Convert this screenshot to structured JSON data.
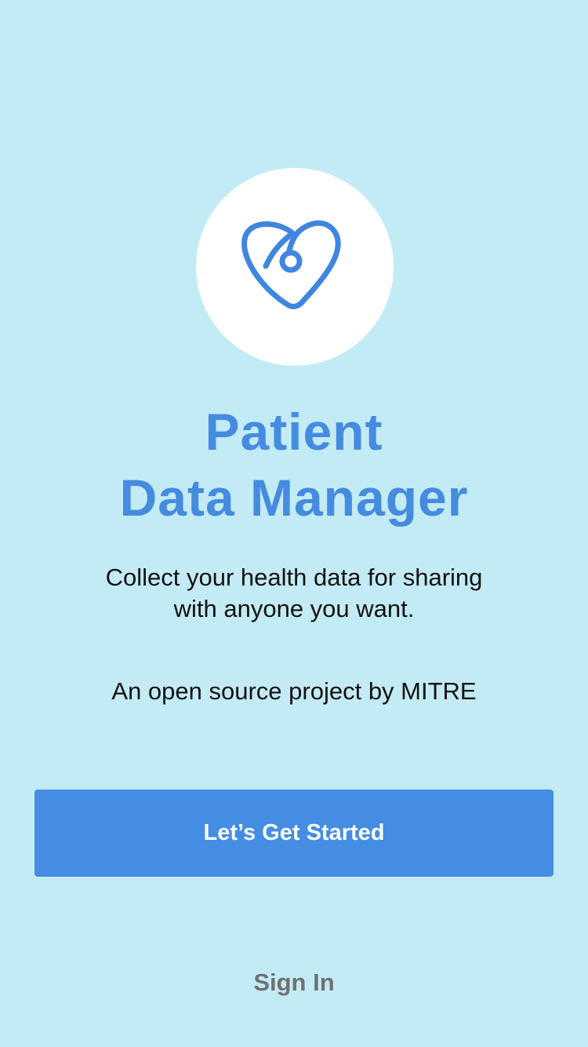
{
  "app": {
    "logo_icon": "heart-stethoscope-icon",
    "title_line1": "Patient",
    "title_line2": "Data Manager",
    "tagline_line1": "Collect your health data for sharing",
    "tagline_line2": "with anyone you want.",
    "credit": "An open source project by MITRE"
  },
  "actions": {
    "get_started_label": "Let’s Get Started",
    "sign_in_label": "Sign In"
  },
  "colors": {
    "background": "#c3ebf5",
    "accent": "#448de3",
    "secondary_text": "#6f7172"
  }
}
